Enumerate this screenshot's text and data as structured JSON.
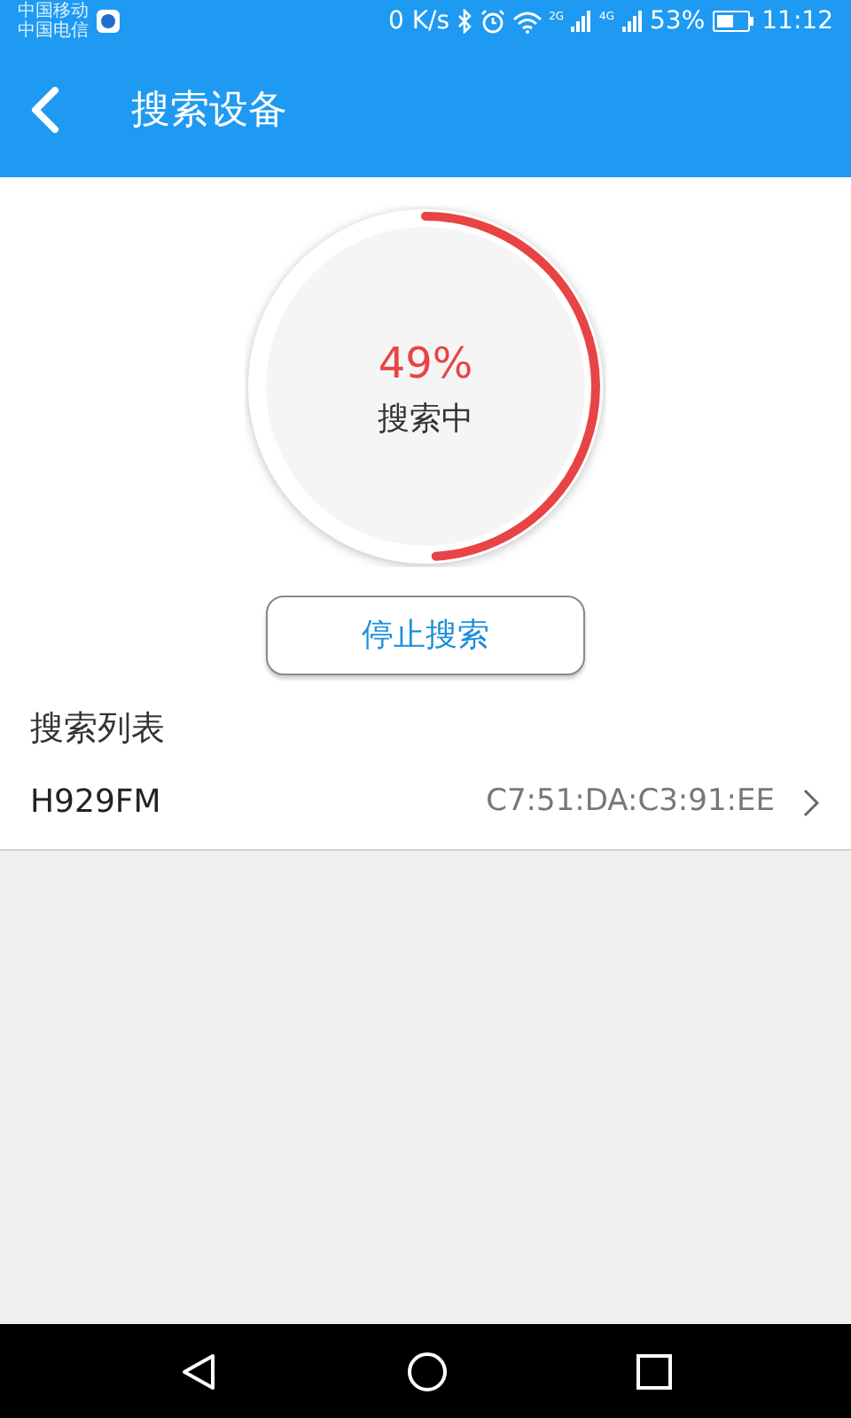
{
  "status_bar": {
    "carriers": [
      "中国移动",
      "中国电信"
    ],
    "net_speed": "0 K/s",
    "signals": [
      "2G",
      "4G"
    ],
    "battery_text": "53%",
    "time": "11:12"
  },
  "header": {
    "title": "搜索设备"
  },
  "progress": {
    "level": 0.49,
    "percent": "49%",
    "label": "搜索中"
  },
  "stop_button": "停止搜索",
  "list": {
    "title": "搜索列表",
    "items": [
      {
        "name": "H929FM",
        "address": "C7:51:DA:C3:91:EE"
      }
    ]
  }
}
